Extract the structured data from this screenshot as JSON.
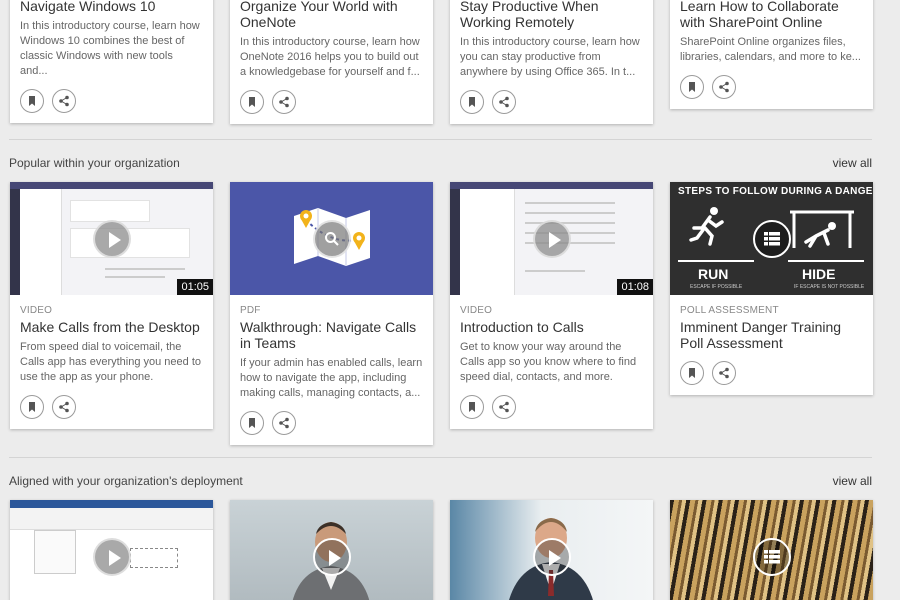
{
  "top_cards": [
    {
      "title": "Navigate Windows 10",
      "desc": "In this introductory course, learn how Windows 10 combines the best of classic Windows with new tools and..."
    },
    {
      "title": "Organize Your World with OneNote",
      "desc": "In this introductory course, learn how OneNote 2016 helps you to build out a knowledgebase for yourself and f..."
    },
    {
      "title": "Stay Productive When Working Remotely",
      "desc": "In this introductory course, learn how you can stay productive from anywhere by using Office 365. In t..."
    },
    {
      "title": "Learn How to Collaborate with SharePoint Online",
      "desc": "SharePoint Online organizes files, libraries, calendars, and more to ke..."
    }
  ],
  "popular": {
    "title": "Popular within your organization",
    "view_all": "view all",
    "cards": [
      {
        "type": "VIDEO",
        "title": "Make Calls from the Desktop",
        "desc": "From speed dial to voicemail, the Calls app has everything you need to use the app as your phone.",
        "duration": "01:05"
      },
      {
        "type": "PDF",
        "title": "Walkthrough: Navigate Calls in Teams",
        "desc": "If your admin has enabled calls, learn how to navigate the app, including making calls, managing contacts, a..."
      },
      {
        "type": "VIDEO",
        "title": "Introduction to Calls",
        "desc": "Get to know your way around the Calls app so you know where to find speed dial, contacts, and more.",
        "duration": "01:08"
      },
      {
        "type": "POLL ASSESSMENT",
        "title": "Imminent Danger Training Poll Assessment",
        "desc": "",
        "poster": {
          "heading": "STEPS TO FOLLOW DURING A DANGE",
          "run": "RUN",
          "run_sub": "ESCAPE IF POSSIBLE",
          "hide": "HIDE",
          "hide_sub": "IF ESCAPE IS NOT POSSIBLE"
        }
      }
    ]
  },
  "aligned": {
    "title": "Aligned with your organization's deployment",
    "view_all": "view all"
  },
  "icons": {
    "bookmark": "bookmark-icon",
    "share": "share-icon",
    "play": "play-icon",
    "list": "list-icon"
  },
  "colors": {
    "pdf_bg": "#4b56a8",
    "poster_bg": "#2f2f2f",
    "map_pin": "#f2b31b"
  }
}
